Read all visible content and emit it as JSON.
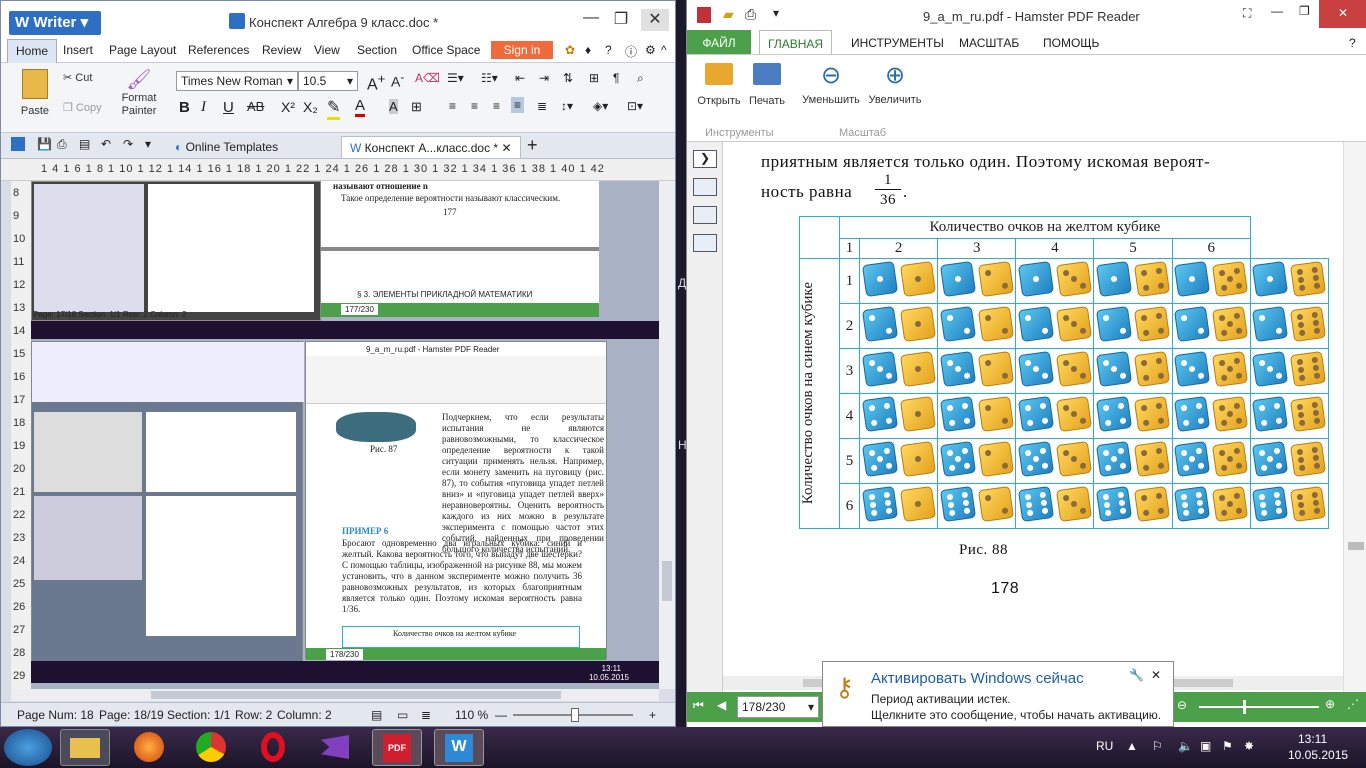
{
  "writer": {
    "app_name": "Writer",
    "doc_title": "Конспект Алгебра 9 класс.doc *",
    "menu": [
      "Home",
      "Insert",
      "Page Layout",
      "References",
      "Review",
      "View",
      "Section",
      "Office Space"
    ],
    "signin": "Sign in",
    "paste": "Paste",
    "cut": "Cut",
    "copy": "Copy",
    "format_painter": "Format\nPainter",
    "font_name": "Times New Roman",
    "font_size": "10.5",
    "tabs": [
      "Online Templates",
      "Конспект А...класс.doc *"
    ],
    "ruler": "1 4 1 6 1 8 1 10 1 12 1 14 1 16 1 18 1 20 1 22 1 24 1 26 1 28 1 30 1 32 1 34 1 36 1 38 1 40 1 42",
    "vruler": [
      "8",
      "9",
      "10",
      "11",
      "12",
      "13",
      "14",
      "15",
      "16",
      "17",
      "18",
      "19",
      "20",
      "21",
      "22",
      "23",
      "24",
      "25",
      "26",
      "27",
      "28",
      "29"
    ],
    "status": {
      "page_num": "Page Num: 18",
      "page": "Page: 18/19",
      "section": "Section: 1/1",
      "row": "Row: 2",
      "column": "Column: 2",
      "zoom": "110 %"
    },
    "nested": {
      "upper_line1": "называют отношение  n",
      "upper_line2": "Такое определение вероятности называют классическим.",
      "page_num": "177",
      "section": "§ 3. ЭЛЕМЕНТЫ ПРИКЛАДНОЙ МАТЕМАТИКИ",
      "pdf_page": "177/230",
      "status_left": "Page: 17/18  Section: 1/1  Row: 2  Column: 2",
      "pdf_title": "9_a_m_ru.pdf - Hamster PDF Reader",
      "pdf_text": "Подчеркнем, что если результаты испытания не являются равновозможными, то классическое определение вероятности к такой ситуации применять нельзя. Например, если монету заменить на пуговицу (рис. 87), то события «пуговица упадет петлей вниз» и «пуговица упадет петлей вверх» неравновероятны. Оценить вероятность каждого из них можно в результате эксперимента с помощью частот этих событий, найденных при проведении большого количества испытаний.",
      "fig": "Рис. 87",
      "example": "ПРИМЕР 6",
      "example_text": "Бросают одновременно два игральных кубика: синий и желтый. Какова вероятность того, что выпадут две шестерки? С помощью таблицы, изображенной на рисунке 88, мы можем установить, что в данном эксперименте можно получить 36 равновозможных результатов, из которых благоприятным является только один. Поэтому искомая вероятность равна 1/36.",
      "table_caption": "Количество очков на желтом кубике",
      "pdf_page_lower": "178/230",
      "time": "13:11",
      "date": "10.05.2015"
    }
  },
  "pdf": {
    "title": "9_a_m_ru.pdf - Hamster PDF Reader",
    "tabs": [
      "ФАЙЛ",
      "ГЛАВНАЯ",
      "ИНСТРУМЕНТЫ",
      "МАСШТАБ",
      "ПОМОЩЬ"
    ],
    "buttons": [
      "Открыть",
      "Печать",
      "Уменьшить",
      "Увеличить"
    ],
    "groups": [
      "Инструменты",
      "Масштаб"
    ],
    "text_line1": "приятным является только один. Поэтому искомая вероят-",
    "text_line2": "ность равна",
    "frac_num": "1",
    "frac_den": "36",
    "table": {
      "top_header": "Количество очков на желтом кубике",
      "side_header": "Количество очков на синем кубике",
      "cols": [
        "1",
        "2",
        "3",
        "4",
        "5",
        "6"
      ],
      "rows": [
        "1",
        "2",
        "3",
        "4",
        "5",
        "6"
      ]
    },
    "figure": "Рис. 88",
    "page_number": "178",
    "page_box": "178/230"
  },
  "notification": {
    "title": "Активировать Windows сейчас",
    "line1": "Период активации истек.",
    "line2": "Щелкните это сообщение, чтобы начать активацию."
  },
  "tray": {
    "lang": "RU",
    "time": "13:11",
    "date": "10.05.2015"
  },
  "colors": {
    "writer_accent": "#2e6fc4",
    "pdf_green": "#4ca04a",
    "die_blue": "#1f7fc0",
    "die_yellow": "#e3a21c"
  }
}
